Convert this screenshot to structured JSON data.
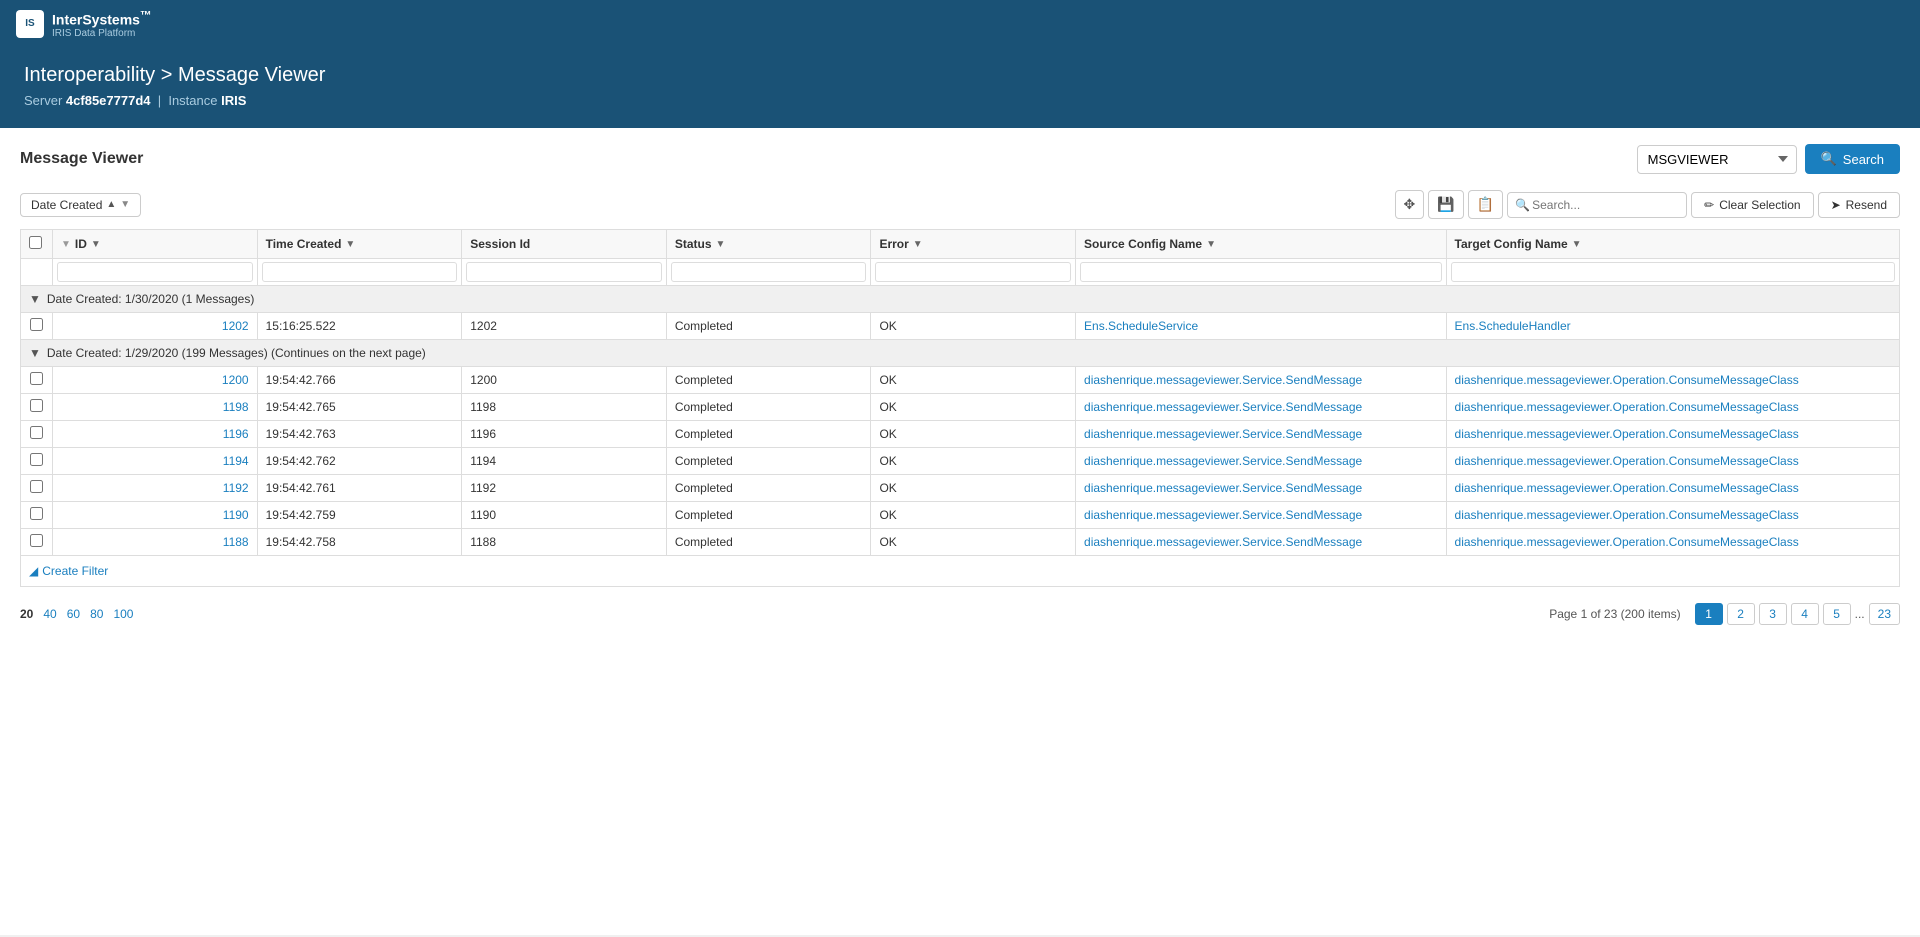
{
  "app": {
    "logo_initials": "IS",
    "brand_name": "InterSystems",
    "brand_tm": "™",
    "brand_subtitle": "IRIS Data Platform"
  },
  "header": {
    "breadcrumb": "Interoperability > Message Viewer",
    "server_label": "Server",
    "server_id": "4cf85e7777d4",
    "instance_label": "Instance",
    "instance_name": "IRIS"
  },
  "page": {
    "title": "Message Viewer"
  },
  "toolbar": {
    "namespace_value": "MSGVIEWER",
    "search_label": "Search",
    "search_placeholder": "Search...",
    "clear_selection_label": "Clear Selection",
    "resend_label": "Resend"
  },
  "filter_bar": {
    "date_created_label": "Date Created",
    "sort_asc": "▲",
    "sort_desc": "▼"
  },
  "table": {
    "columns": [
      {
        "id": "checkbox",
        "label": ""
      },
      {
        "id": "id",
        "label": "ID"
      },
      {
        "id": "time_created",
        "label": "Time Created"
      },
      {
        "id": "session_id",
        "label": "Session Id"
      },
      {
        "id": "status",
        "label": "Status"
      },
      {
        "id": "error",
        "label": "Error"
      },
      {
        "id": "source_config_name",
        "label": "Source Config Name"
      },
      {
        "id": "target_config_name",
        "label": "Target Config Name"
      }
    ],
    "groups": [
      {
        "label": "Date Created: 1/30/2020 (1 Messages)",
        "rows": [
          {
            "id": "1202",
            "time_created": "15:16:25.522",
            "session_id": "1202",
            "status": "Completed",
            "error": "OK",
            "source_config_name": "Ens.ScheduleService",
            "target_config_name": "Ens.ScheduleHandler"
          }
        ]
      },
      {
        "label": "Date Created: 1/29/2020 (199 Messages) (Continues on the next page)",
        "rows": [
          {
            "id": "1200",
            "time_created": "19:54:42.766",
            "session_id": "1200",
            "status": "Completed",
            "error": "OK",
            "source_config_name": "diashenrique.messageviewer.Service.SendMessage",
            "target_config_name": "diashenrique.messageviewer.Operation.ConsumeMessageClass"
          },
          {
            "id": "1198",
            "time_created": "19:54:42.765",
            "session_id": "1198",
            "status": "Completed",
            "error": "OK",
            "source_config_name": "diashenrique.messageviewer.Service.SendMessage",
            "target_config_name": "diashenrique.messageviewer.Operation.ConsumeMessageClass"
          },
          {
            "id": "1196",
            "time_created": "19:54:42.763",
            "session_id": "1196",
            "status": "Completed",
            "error": "OK",
            "source_config_name": "diashenrique.messageviewer.Service.SendMessage",
            "target_config_name": "diashenrique.messageviewer.Operation.ConsumeMessageClass"
          },
          {
            "id": "1194",
            "time_created": "19:54:42.762",
            "session_id": "1194",
            "status": "Completed",
            "error": "OK",
            "source_config_name": "diashenrique.messageviewer.Service.SendMessage",
            "target_config_name": "diashenrique.messageviewer.Operation.ConsumeMessageClass"
          },
          {
            "id": "1192",
            "time_created": "19:54:42.761",
            "session_id": "1192",
            "status": "Completed",
            "error": "OK",
            "source_config_name": "diashenrique.messageviewer.Service.SendMessage",
            "target_config_name": "diashenrique.messageviewer.Operation.ConsumeMessageClass"
          },
          {
            "id": "1190",
            "time_created": "19:54:42.759",
            "session_id": "1190",
            "status": "Completed",
            "error": "OK",
            "source_config_name": "diashenrique.messageviewer.Service.SendMessage",
            "target_config_name": "diashenrique.messageviewer.Operation.ConsumeMessageClass"
          },
          {
            "id": "1188",
            "time_created": "19:54:42.758",
            "session_id": "1188",
            "status": "Completed",
            "error": "OK",
            "source_config_name": "diashenrique.messageviewer.Service.SendMessage",
            "target_config_name": "diashenrique.messageviewer.Operation.ConsumeMessageClass"
          }
        ]
      }
    ],
    "create_filter_label": "Create Filter"
  },
  "pagination": {
    "page_sizes": [
      "20",
      "40",
      "60",
      "80",
      "100"
    ],
    "page_info": "Page 1 of 23 (200 items)",
    "pages": [
      "1",
      "2",
      "3",
      "4",
      "5",
      "...",
      "23"
    ],
    "current_page": "1"
  }
}
